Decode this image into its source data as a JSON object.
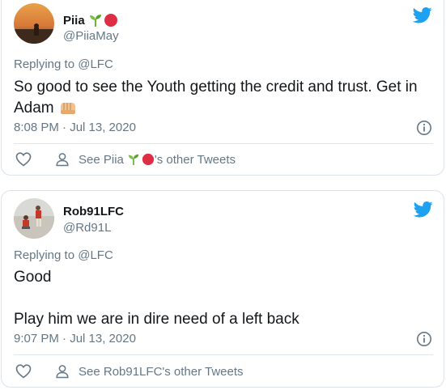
{
  "tweets": [
    {
      "name": "Piia",
      "handle": "@PiiaMay",
      "replying": "Replying to @LFC",
      "lines": [
        "So good to see the Youth getting the credit and trust. Get in",
        "Adam"
      ],
      "time": "8:08 PM · Jul 13, 2020",
      "see_prefix": "See Piia",
      "see_suffix": "'s other Tweets",
      "name_emoji": [
        "seedling-icon",
        "red-circle-icon"
      ],
      "body_emoji": "oncoming-fist-icon"
    },
    {
      "name": "Rob91LFC",
      "handle": "@Rd91L",
      "replying": "Replying to @LFC",
      "lines": [
        "Good",
        "",
        "Play him we are in dire need of a left back"
      ],
      "time": "9:07 PM · Jul 13, 2020",
      "see_text": "See Rob91LFC's other Tweets"
    }
  ],
  "colors": {
    "twitter_blue": "#1da1f2",
    "secondary_text": "#657786",
    "primary_text": "#14171a",
    "border": "#dbe2e8"
  }
}
